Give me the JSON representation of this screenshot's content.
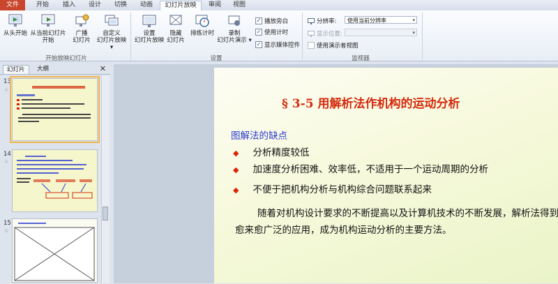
{
  "ribbon_tabs": [
    "文件",
    "开始",
    "插入",
    "设计",
    "切换",
    "动画",
    "幻灯片放映",
    "审阅",
    "视图"
  ],
  "ribbon": {
    "start_group": {
      "from_beginning": "从头开始",
      "from_current": "从当前幻灯片",
      "from_current_2": "开始",
      "broadcast": "广播",
      "broadcast_2": "幻灯片",
      "custom": "自定义",
      "custom_2": "幻灯片放映 ▾",
      "label": "开始放映幻灯片"
    },
    "setup_group": {
      "setup": "设置",
      "setup_2": "幻灯片放映",
      "hide": "隐藏",
      "hide_2": "幻灯片",
      "rehearse": "排练计时",
      "record": "录制",
      "record_2": "幻灯片演示 ▾",
      "chk_narration": "播放旁白",
      "chk_timings": "使用计时",
      "chk_media": "显示媒体控件",
      "label": "设置"
    },
    "monitor_group": {
      "resolution_label": "分辨率:",
      "resolution_value": "使用当前分辨率",
      "show_on_label": "显示位置:",
      "presenter_view": "使用演示者视图",
      "label": "监视器"
    }
  },
  "pane": {
    "tab_slides": "幻灯片",
    "tab_outline": "大纲",
    "close": "✕",
    "slide_numbers": [
      "13",
      "14",
      "15"
    ]
  },
  "slide": {
    "title": "§ 3-5  用解析法作机构的运动分析",
    "subtitle": "图解法的缺点",
    "bullets": [
      "分析精度较低",
      "加速度分析困难、效率低，不适用于一个运动周期的分析",
      "不便于把机构分析与机构综合问题联系起来"
    ],
    "paragraph": "随着对机构设计要求的不断提高以及计算机技术的不断发展，解析法得到愈来愈广泛的应用，成为机构运动分析的主要方法。"
  },
  "colors": {
    "file_tab": "#c9462c",
    "title_red": "#d42a0c",
    "subtitle_blue": "#2a3bd0",
    "bullet_red": "#e0220a",
    "slide_bg": "#f7f9dc",
    "selected_thumb_outline": "#f2b34a"
  }
}
